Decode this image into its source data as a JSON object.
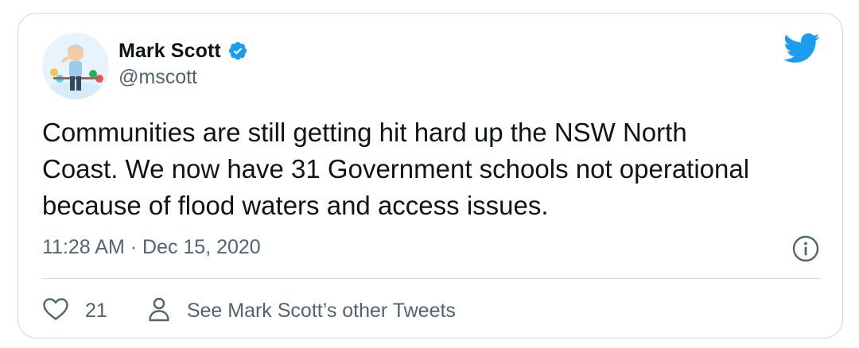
{
  "author": {
    "name": "Mark Scott",
    "handle": "@mscott",
    "verified": true
  },
  "tweet": {
    "text_lines": [
      "Communities are still getting hit hard up the NSW North",
      "Coast. We now have 31 Government schools not operational",
      "because of flood waters and access issues."
    ],
    "timestamp": "11:28 AM · Dec 15, 2020"
  },
  "actions": {
    "like_count": "21",
    "see_more_label": "See Mark Scott’s other Tweets"
  },
  "icons": {
    "verified": "verified-badge-icon",
    "brand": "twitter-bird-icon",
    "info": "info-icon",
    "like": "heart-outline-icon",
    "profile": "person-outline-icon"
  },
  "colors": {
    "brand_blue": "#1d9bf0",
    "text_primary": "#0f1419",
    "text_secondary": "#536471",
    "border": "#cfd9de"
  }
}
